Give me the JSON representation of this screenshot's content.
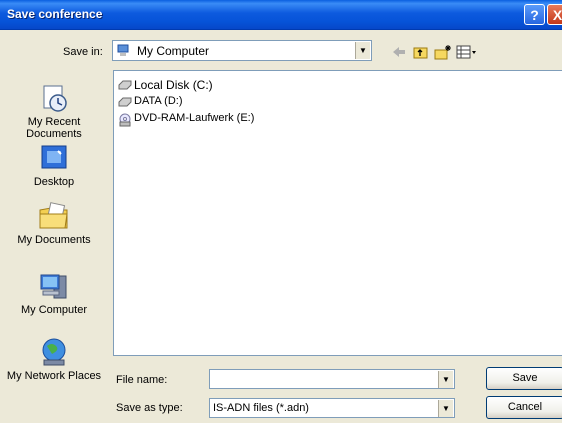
{
  "window": {
    "title": "Save conference",
    "help_glyph": "?",
    "close_glyph": "X"
  },
  "toolbar": {
    "save_in_label": "Save in:",
    "save_in_value": "My Computer",
    "icons": [
      "back-arrow-icon",
      "up-folder-icon",
      "new-folder-icon",
      "views-menu-icon"
    ]
  },
  "places": [
    {
      "label": "My Recent Documents",
      "icon": "recent-documents-icon"
    },
    {
      "label": "Desktop",
      "icon": "desktop-icon"
    },
    {
      "label": "My Documents",
      "icon": "my-documents-icon"
    },
    {
      "label": "My Computer",
      "icon": "my-computer-icon"
    },
    {
      "label": "My Network Places",
      "icon": "network-places-icon"
    }
  ],
  "files": [
    {
      "label": "Local Disk (C:)",
      "icon": "hard-disk-icon"
    },
    {
      "label": "DATA (D:)",
      "icon": "hard-disk-icon"
    },
    {
      "label": "DVD-RAM-Laufwerk (E:)",
      "icon": "dvd-drive-icon"
    }
  ],
  "form": {
    "file_name_label": "File name:",
    "file_name_value": "",
    "save_as_type_label": "Save as type:",
    "save_as_type_value": "IS-ADN files (*.adn)",
    "save_button": "Save",
    "cancel_button": "Cancel"
  }
}
